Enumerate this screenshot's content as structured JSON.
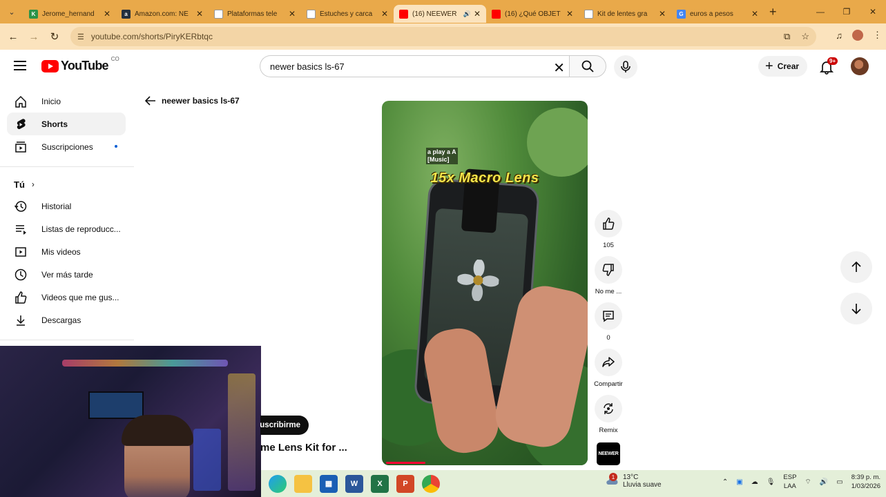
{
  "browser": {
    "tabs": [
      {
        "title": "Jerome_hernand",
        "favicon_color": "#2b9348",
        "favicon_letter": "K",
        "active": false
      },
      {
        "title": "Amazon.com: NE",
        "favicon_color": "#232f3e",
        "favicon_letter": "a",
        "active": false
      },
      {
        "title": "Plataformas tele",
        "favicon_color": "#ffffff",
        "favicon_letter": "",
        "active": false
      },
      {
        "title": "Estuches y carca",
        "favicon_color": "#ffffff",
        "favicon_letter": "",
        "active": false
      },
      {
        "title": "(16) NEEWER",
        "favicon_color": "#ff0000",
        "favicon_letter": "",
        "active": true,
        "audio": true
      },
      {
        "title": "(16) ¿Qué OBJET",
        "favicon_color": "#ff0000",
        "favicon_letter": "",
        "active": false
      },
      {
        "title": "Kit de lentes gra",
        "favicon_color": "#ffffff",
        "favicon_letter": "",
        "active": false
      },
      {
        "title": "euros a pesos",
        "favicon_color": "#4285f4",
        "favicon_letter": "G",
        "active": false
      }
    ],
    "url": "youtube.com/shorts/PiryKERbtqc"
  },
  "header": {
    "logo_text": "YouTube",
    "country_code": "CO",
    "search_value": "newer basics ls-67",
    "create_label": "Crear",
    "notification_count": "9+"
  },
  "sidebar": {
    "main": [
      {
        "label": "Inicio",
        "icon": "home-icon",
        "active": false
      },
      {
        "label": "Shorts",
        "icon": "shorts-icon",
        "active": true
      },
      {
        "label": "Suscripciones",
        "icon": "subscriptions-icon",
        "active": false,
        "dot": true
      }
    ],
    "you_heading": "Tú",
    "you": [
      {
        "label": "Historial",
        "icon": "history-icon"
      },
      {
        "label": "Listas de reproducc...",
        "icon": "playlists-icon"
      },
      {
        "label": "Mis videos",
        "icon": "your-videos-icon"
      },
      {
        "label": "Ver más tarde",
        "icon": "watch-later-icon"
      },
      {
        "label": "Videos que me gus...",
        "icon": "liked-videos-icon"
      },
      {
        "label": "Descargas",
        "icon": "downloads-icon"
      }
    ]
  },
  "back_link": "neewer basics ls-67",
  "video": {
    "caption_line1": "a play a A",
    "caption_line2": "[Music]",
    "overlay_title": "15x Macro  Lens",
    "progress": 0.2
  },
  "actions": {
    "like_count": "105",
    "dislike_label": "No me ...",
    "comment_count": "0",
    "share_label": "Compartir",
    "remix_label": "Remix"
  },
  "channel_logo_text": "NEEWER",
  "subscribe_label": "uscribirme",
  "video_title_fragment": "me Lens Kit for ...",
  "taskbar": {
    "weather_temp": "13°C",
    "weather_desc": "Lluvia suave",
    "weather_alerts": "1",
    "lang_line1": "ESP",
    "lang_line2": "LAA",
    "time": "8:39 p. m.",
    "date": "1/03/2026"
  },
  "colors": {
    "tabstrip": "#e9a94a",
    "toolbar": "#fbe3bd",
    "youtube_red": "#ff0000",
    "taskbar": "#e4efd9"
  }
}
